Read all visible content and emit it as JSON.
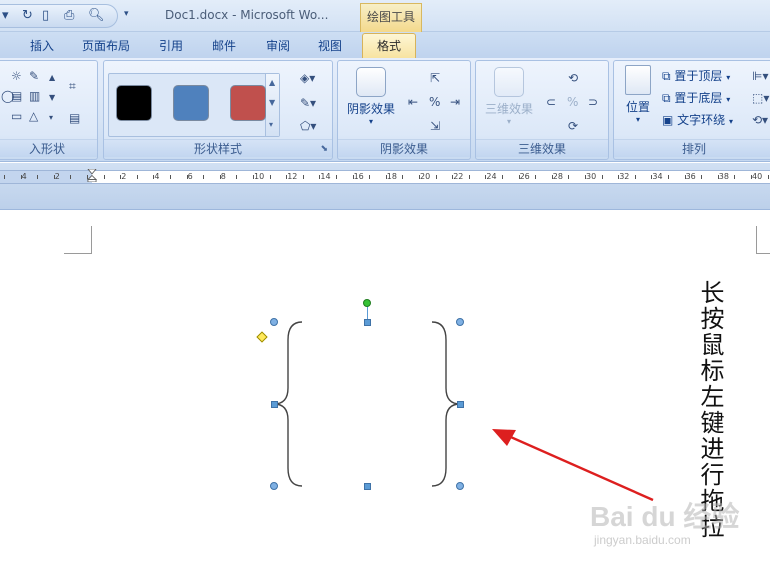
{
  "titlebar": {
    "doc_title": "Doc1.docx - Microsoft Wo...",
    "context_group": "绘图工具"
  },
  "tabs": [
    "插入",
    "页面布局",
    "引用",
    "邮件",
    "审阅",
    "视图"
  ],
  "active_tab": "格式",
  "ribbon": {
    "insert_shapes_label": "入形状",
    "shape_styles_label": "形状样式",
    "shadow_effects_btn": "阴影效果",
    "shadow_effects_label": "阴影效果",
    "threed_btn": "三维效果",
    "threed_label": "三维效果",
    "position_btn": "位置",
    "arrange_label": "排列",
    "bring_front": "置于顶层",
    "send_back": "置于底层",
    "text_wrap": "文字环绕"
  },
  "swatch_colors": [
    "#000000",
    "#4f81bd",
    "#c0504d"
  ],
  "ruler_numbers": [
    "4",
    "2",
    "2",
    "4",
    "6",
    "8",
    "10",
    "12",
    "14",
    "16",
    "18",
    "20",
    "22",
    "24",
    "26",
    "28",
    "30",
    "32",
    "34",
    "36",
    "38",
    "40"
  ],
  "document": {
    "instruction_text": "长按鼠标左键进行拖拉",
    "watermark": "Bai du 经验",
    "watermark_url": "jingyan.baidu.com"
  },
  "colors": {
    "arrow": "#dd1f1f",
    "handle": "#5b9bd5",
    "rotate_handle": "#36c236",
    "adjust_handle": "#ffe95a"
  }
}
